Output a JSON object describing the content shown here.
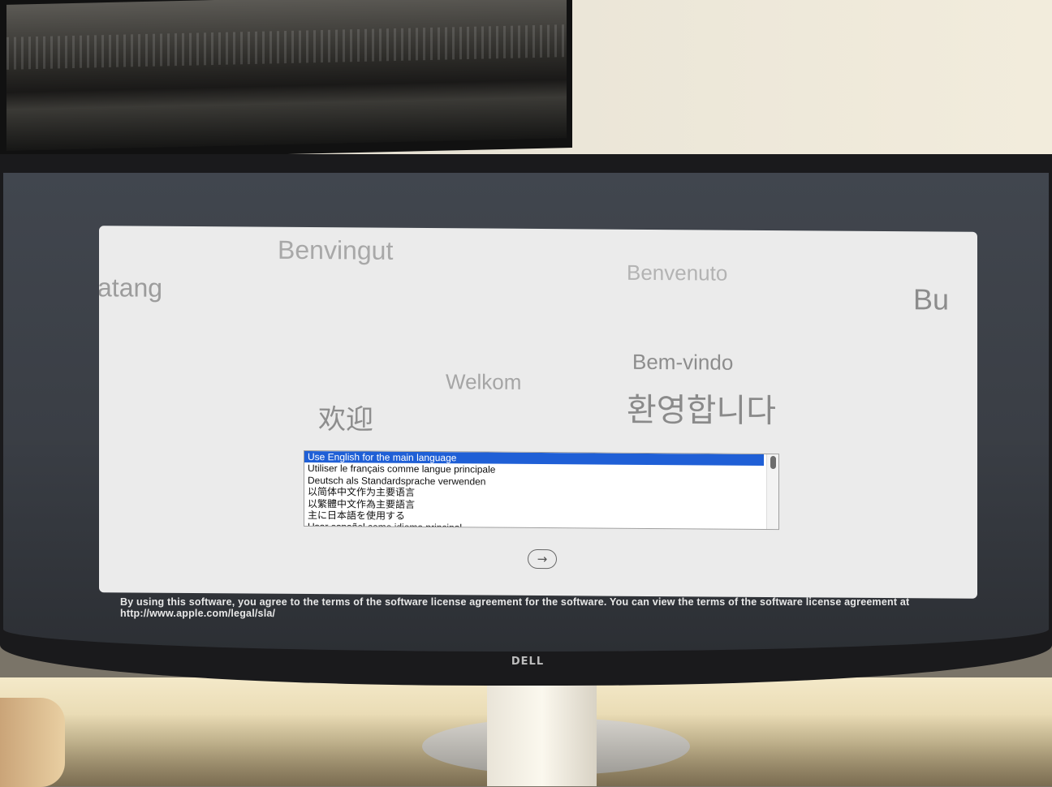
{
  "welcome_words": [
    "Benvingut",
    "atang",
    "Benvenuto",
    "Bu",
    "Bem-vindo",
    "Welkom",
    "환영합니다",
    "欢迎"
  ],
  "language_list": {
    "items": [
      "Use English for the main language",
      "Utiliser le français comme langue principale",
      "Deutsch als Standardsprache verwenden",
      "以简体中文作为主要语言",
      "以繁體中文作為主要語言",
      "主に日本語を使用する",
      "Usar español como idioma principal"
    ],
    "selected_index": 0
  },
  "next_button": {
    "icon": "arrow-right-circle-icon",
    "glyph": "→"
  },
  "legal_text": "By using this software, you agree to the terms of the software license agreement for the software. You can view the terms of the software license agreement at http://www.apple.com/legal/sla/",
  "monitor": {
    "brand": "DELL"
  },
  "colors": {
    "selection": "#1f5fd6",
    "window": "#ebebeb",
    "screen_bg": "#3a3e45"
  }
}
